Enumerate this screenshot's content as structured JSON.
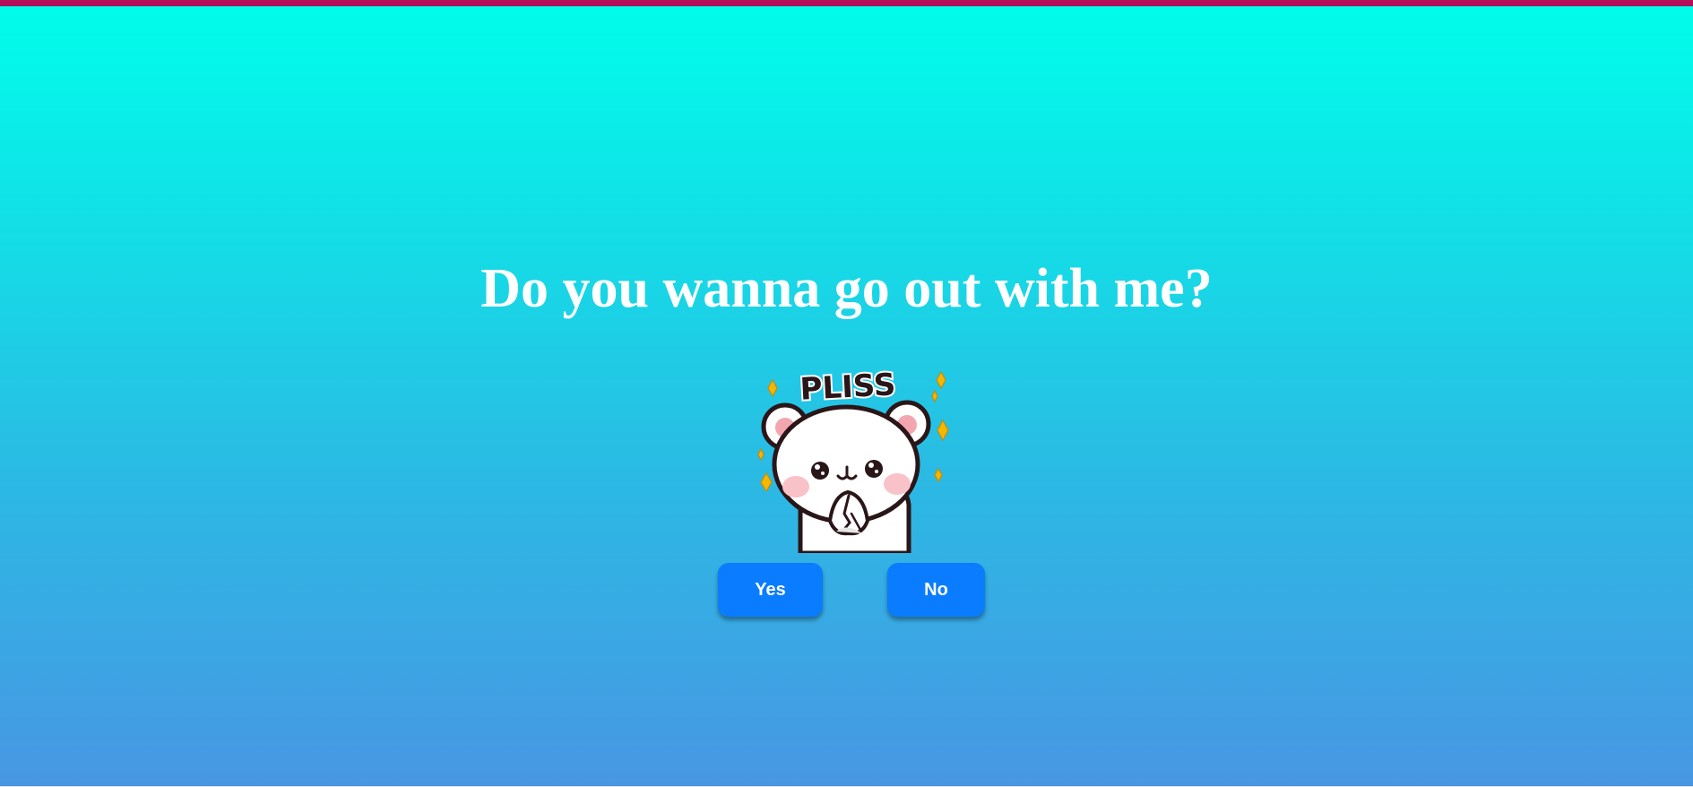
{
  "question": "Do you wanna go out with me?",
  "sticker": {
    "caption": "PLISS",
    "icon": "bear-begging-icon"
  },
  "buttons": {
    "yes_label": "Yes",
    "no_label": "No"
  },
  "colors": {
    "top_bar": "#b3125a",
    "gradient_top": "#00fdeb",
    "gradient_bottom": "#4897e3",
    "button": "#0a7cff",
    "text": "#ffffff"
  }
}
